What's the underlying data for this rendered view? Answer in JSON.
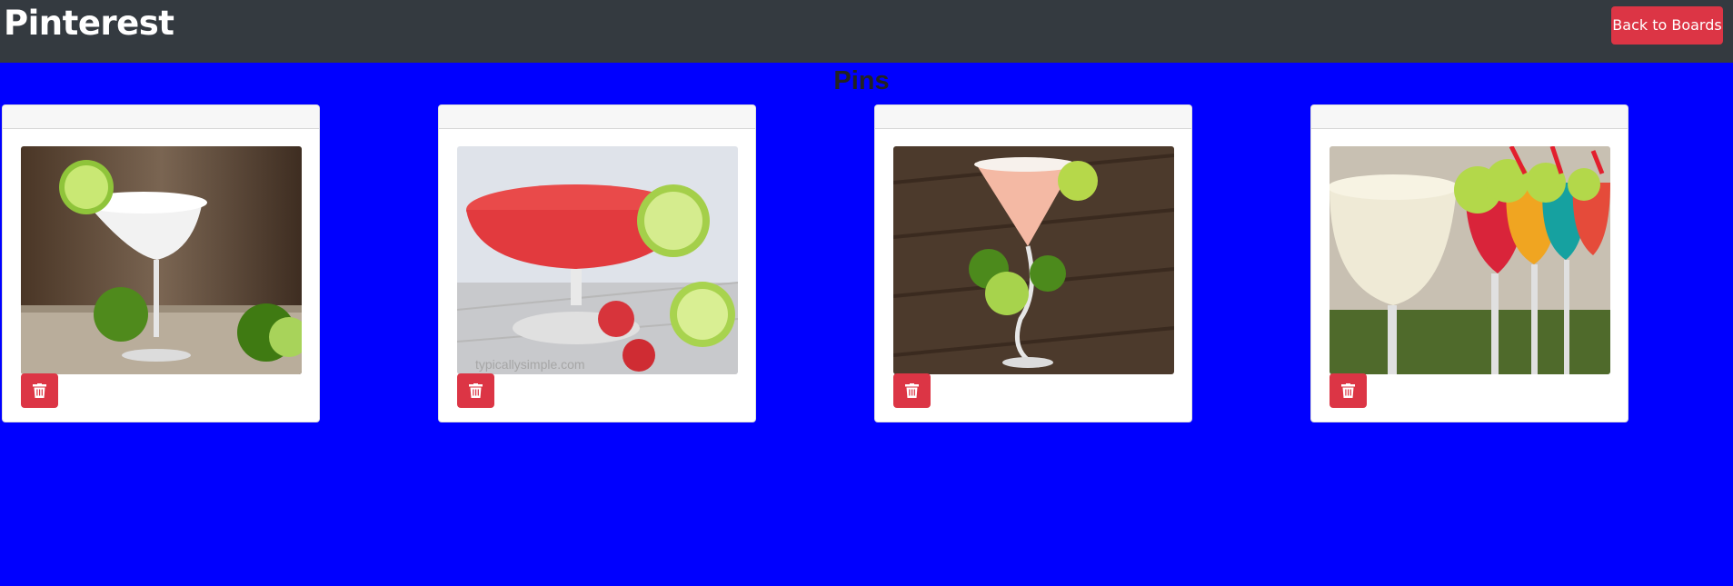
{
  "navbar": {
    "brand": "Pinterest",
    "back_button": "Back to Boards"
  },
  "page": {
    "title": "Pins"
  },
  "pins": [
    {
      "image_name": "frozen-margarita-image",
      "delete_icon": "trash-icon"
    },
    {
      "image_name": "strawberry-margarita-image",
      "delete_icon": "trash-icon",
      "watermark": "typicallysimple.com"
    },
    {
      "image_name": "pink-martini-image",
      "delete_icon": "trash-icon"
    },
    {
      "image_name": "colorful-daiquiris-image",
      "delete_icon": "trash-icon"
    }
  ],
  "colors": {
    "background": "#0000ff",
    "navbar": "#343a40",
    "danger": "#dc3545"
  }
}
